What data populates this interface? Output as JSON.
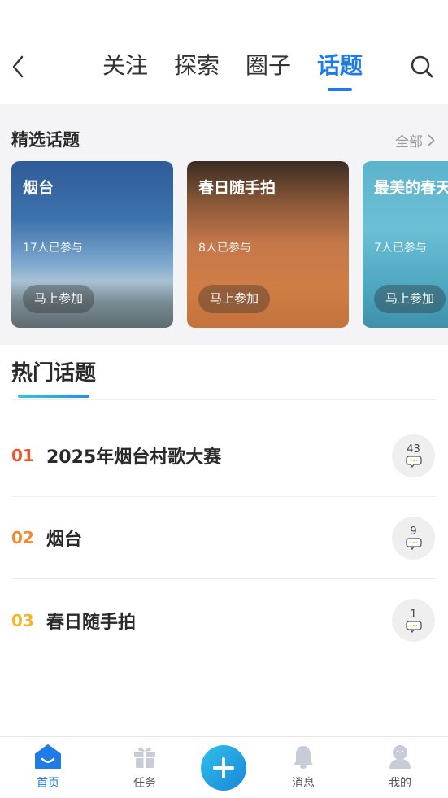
{
  "header": {
    "tabs": [
      {
        "label": "关注"
      },
      {
        "label": "探索"
      },
      {
        "label": "圈子"
      },
      {
        "label": "话题"
      }
    ],
    "active_tab": 3
  },
  "featured": {
    "title": "精选话题",
    "all_label": "全部",
    "cards": [
      {
        "title": "烟台",
        "count": "17人已参与",
        "join": "马上参加"
      },
      {
        "title": "春日随手拍",
        "count": "8人已参与",
        "join": "马上参加"
      },
      {
        "title": "最美的春天",
        "count": "7人已参与",
        "join": "马上参加"
      }
    ]
  },
  "hot": {
    "title": "热门话题",
    "items": [
      {
        "rank": "01",
        "name": "2025年烟台村歌大赛",
        "comments": "43",
        "rank_color": "#f0522d"
      },
      {
        "rank": "02",
        "name": "烟台",
        "comments": "9",
        "rank_color": "#f5882a"
      },
      {
        "rank": "03",
        "name": "春日随手拍",
        "comments": "1",
        "rank_color": "#f5b52a"
      }
    ]
  },
  "tabbar": {
    "items": [
      {
        "label": "首页",
        "icon": "home-icon"
      },
      {
        "label": "任务",
        "icon": "gift-icon"
      },
      {
        "label": "消息",
        "icon": "bell-icon"
      },
      {
        "label": "我的",
        "icon": "user-icon"
      }
    ],
    "center_icon": "plus-icon"
  },
  "colors": {
    "accent": "#1e7be8",
    "icon_gray": "#c8ccd6"
  }
}
